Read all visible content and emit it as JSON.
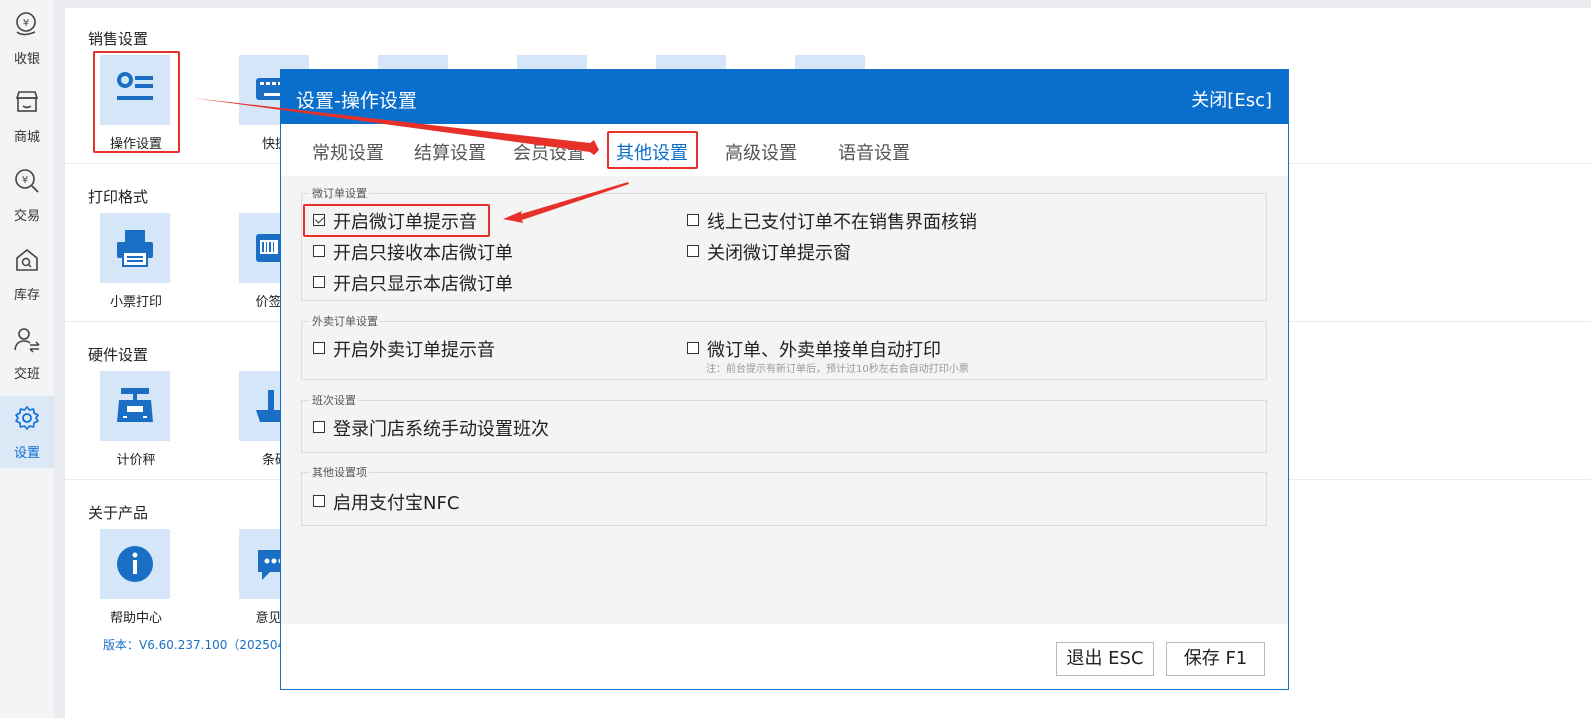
{
  "sidebar": {
    "items": [
      {
        "label": "收银",
        "icon": "cash-register-icon"
      },
      {
        "label": "商城",
        "icon": "store-icon"
      },
      {
        "label": "交易",
        "icon": "transaction-icon"
      },
      {
        "label": "库存",
        "icon": "inventory-icon"
      },
      {
        "label": "交班",
        "icon": "shift-handover-icon"
      },
      {
        "label": "设置",
        "icon": "gear-icon",
        "active": true
      }
    ]
  },
  "main": {
    "sections": [
      {
        "title": "销售设置",
        "tiles": [
          "操作设置",
          "快捷"
        ]
      },
      {
        "title": "打印格式",
        "tiles": [
          "小票打印",
          "价签打"
        ]
      },
      {
        "title": "硬件设置",
        "tiles": [
          "计价秤",
          "条码"
        ]
      },
      {
        "title": "关于产品",
        "tiles": [
          "帮助中心",
          "意见反"
        ]
      }
    ],
    "version": "版本：V6.60.237.100（2025042"
  },
  "dialog": {
    "title": "设置-操作设置",
    "close_label": "关闭[Esc]",
    "tabs": [
      "常规设置",
      "结算设置",
      "会员设置",
      "其他设置",
      "高级设置",
      "语音设置"
    ],
    "active_tab": "其他设置",
    "groups": [
      {
        "title": "微订单设置",
        "options": [
          {
            "label": "开启微订单提示音",
            "checked": true
          },
          {
            "label": "线上已支付订单不在销售界面核销",
            "checked": false
          },
          {
            "label": "开启只接收本店微订单",
            "checked": false
          },
          {
            "label": "关闭微订单提示窗",
            "checked": false
          },
          {
            "label": "开启只显示本店微订单",
            "checked": false
          }
        ]
      },
      {
        "title": "外卖订单设置",
        "options": [
          {
            "label": "开启外卖订单提示音",
            "checked": false
          },
          {
            "label": "微订单、外卖单接单自动打印",
            "checked": false
          }
        ],
        "note": "注：前台提示有新订单后，预计过10秒左右会自动打印小票"
      },
      {
        "title": "班次设置",
        "options": [
          {
            "label": "登录门店系统手动设置班次",
            "checked": false
          }
        ]
      },
      {
        "title": "其他设置项",
        "options": [
          {
            "label": "启用支付宝NFC",
            "checked": false
          }
        ]
      }
    ],
    "buttons": {
      "exit_label": "退出 ESC",
      "save_label": "保存 F1"
    }
  },
  "colors": {
    "accent": "#0a6fcc",
    "annotation": "#e8302a",
    "tile_bg": "#d5e6f8"
  }
}
